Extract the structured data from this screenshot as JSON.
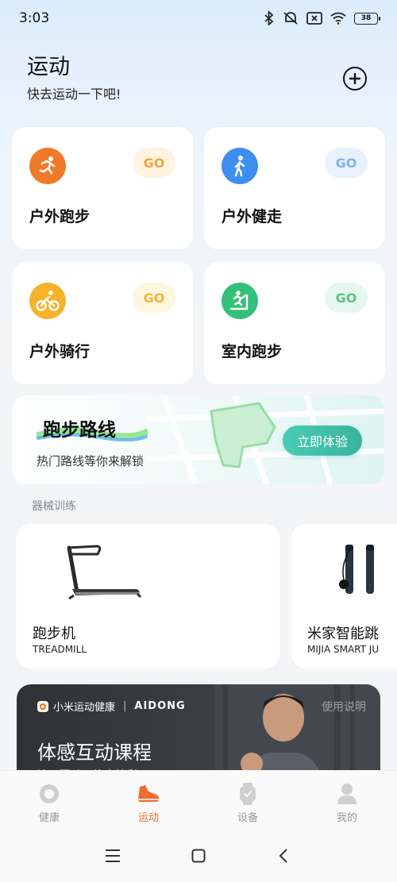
{
  "status_bar": {
    "time": "3:03",
    "battery": "38"
  },
  "header": {
    "title": "运动",
    "subtitle": "快去运动一下吧!"
  },
  "sports": [
    {
      "label": "户外跑步",
      "go": "GO",
      "icon": "running-icon",
      "color": "#f07a2a"
    },
    {
      "label": "户外健走",
      "go": "GO",
      "icon": "walking-icon",
      "color": "#3d8ef0"
    },
    {
      "label": "户外骑行",
      "go": "GO",
      "icon": "cycling-icon",
      "color": "#f5b22a"
    },
    {
      "label": "室内跑步",
      "go": "GO",
      "icon": "treadmill-icon",
      "color": "#34c07a"
    }
  ],
  "route_banner": {
    "title": "跑步路线",
    "subtitle": "热门路线等你来解锁",
    "button": "立即体验"
  },
  "equipment_section": {
    "title": "器械训练"
  },
  "equipment": [
    {
      "name": "跑步机",
      "sub": "TREADMILL"
    },
    {
      "name": "米家智能跳",
      "sub": "MIJIA SMART JU"
    }
  ],
  "promo": {
    "brand": "小米运动健康",
    "partner": "AIDONG",
    "help": "使用说明",
    "title": "体感互动课程",
    "subtitle": "边玩互动，练出精彩!"
  },
  "bottom_nav": [
    {
      "label": "健康",
      "icon": "health-icon",
      "active": false
    },
    {
      "label": "运动",
      "icon": "shoe-icon",
      "active": true
    },
    {
      "label": "设备",
      "icon": "watch-icon",
      "active": false
    },
    {
      "label": "我的",
      "icon": "profile-icon",
      "active": false
    }
  ],
  "colors": {
    "accent": "#f26a2e",
    "go_teal": "#3ab39f"
  }
}
